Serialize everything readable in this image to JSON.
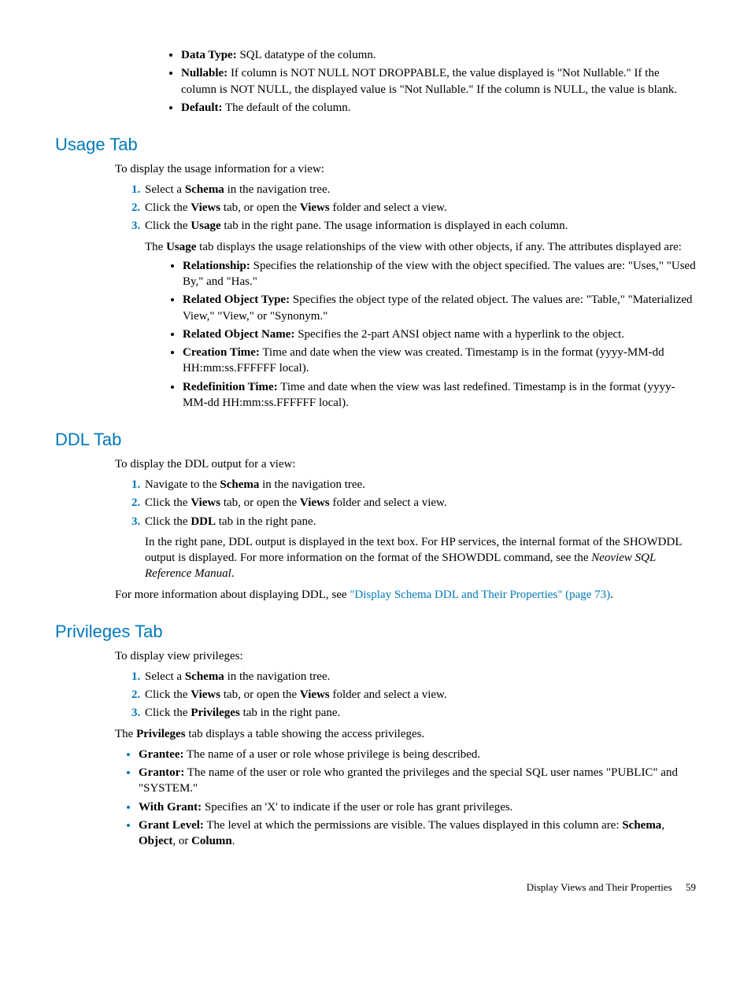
{
  "top_bullets": [
    {
      "label": "Data Type:",
      "text": " SQL datatype of the column."
    },
    {
      "label": "Nullable:",
      "text": " If column is NOT NULL NOT DROPPABLE, the value displayed is \"Not Nullable.\" If the column is NOT NULL, the displayed value is \"Not Nullable.\" If the column is NULL, the value is blank."
    },
    {
      "label": "Default:",
      "text": " The default of the column."
    }
  ],
  "usage": {
    "heading": "Usage Tab",
    "intro": "To display the usage information for a view:",
    "steps": [
      {
        "pre": "Select a ",
        "b": "Schema",
        "post": " in the navigation tree."
      },
      {
        "pre": "Click the ",
        "b": "Views",
        "mid": " tab, or open the ",
        "b2": "Views",
        "post": " folder and select a view."
      },
      {
        "pre": "Click the ",
        "b": "Usage",
        "post": " tab in the right pane. The usage information is displayed in each column."
      }
    ],
    "para_pre": "The ",
    "para_b": "Usage",
    "para_post": " tab displays the usage relationships of the view with other objects, if any. The attributes displayed are:",
    "bullets": [
      {
        "label": "Relationship:",
        "text": " Specifies the relationship of the view with the object specified. The values are: \"Uses,\" \"Used By,\" and \"Has.\""
      },
      {
        "label": "Related Object Type:",
        "text": " Specifies the object type of the related object. The values are: \"Table,\" \"Materialized View,\" \"View,\" or \"Synonym.\""
      },
      {
        "label": "Related Object Name:",
        "text": " Specifies the 2-part ANSI object name with a hyperlink to the object."
      },
      {
        "label": "Creation Time:",
        "text": " Time and date when the view was created. Timestamp is in the format (yyyy-MM-dd HH:mm:ss.FFFFFF local)."
      },
      {
        "label": "Redefinition Time:",
        "text": " Time and date when the view was last redefined. Timestamp is in the format (yyyy-MM-dd HH:mm:ss.FFFFFF local)."
      }
    ]
  },
  "ddl": {
    "heading": "DDL Tab",
    "intro": "To display the DDL output for a view:",
    "steps": [
      {
        "pre": "Navigate to the ",
        "b": "Schema",
        "post": " in the navigation tree."
      },
      {
        "pre": "Click the ",
        "b": "Views",
        "mid": " tab, or open the ",
        "b2": "Views",
        "post": " folder and select a view."
      },
      {
        "pre": "Click the ",
        "b": "DDL",
        "post": " tab in the right pane."
      }
    ],
    "para3_pre": "In the right pane, DDL output is displayed in the text box. For HP services, the internal format of the SHOWDDL output is displayed. For more information on the format of the SHOWDDL command, see the ",
    "para3_ital": "Neoview SQL Reference Manual",
    "para3_post": ".",
    "after_pre": "For more information about displaying DDL, see ",
    "after_link": "\"Display Schema DDL and Their Properties\" (page 73)",
    "after_post": "."
  },
  "priv": {
    "heading": "Privileges Tab",
    "intro": "To display view privileges:",
    "steps": [
      {
        "pre": "Select a ",
        "b": "Schema",
        "post": " in the navigation tree."
      },
      {
        "pre": "Click the ",
        "b": "Views",
        "mid": " tab, or open the ",
        "b2": "Views",
        "post": " folder and select a view."
      },
      {
        "pre": "Click the ",
        "b": "Privileges",
        "post": " tab in the right pane."
      }
    ],
    "para_pre": "The ",
    "para_b": "Privileges",
    "para_post": " tab displays a table showing the access privileges.",
    "bullets": [
      {
        "label": "Grantee:",
        "text": " The name of a user or role whose privilege is being described."
      },
      {
        "label": "Grantor:",
        "text": " The name of the user or role who granted the privileges and the special SQL user names \"PUBLIC\" and \"SYSTEM.\""
      },
      {
        "label": "With Grant:",
        "text": " Specifies an 'X' to indicate if the user or role has grant privileges."
      },
      {
        "label": "Grant Level:",
        "pre": " The level at which the permissions are visible. The values displayed in this column are: ",
        "b1": "Schema",
        "sep1": ", ",
        "b2": "Object",
        "sep2": ", or ",
        "b3": "Column",
        "post": "."
      }
    ]
  },
  "footer": {
    "title": "Display Views and Their Properties",
    "page": "59"
  }
}
